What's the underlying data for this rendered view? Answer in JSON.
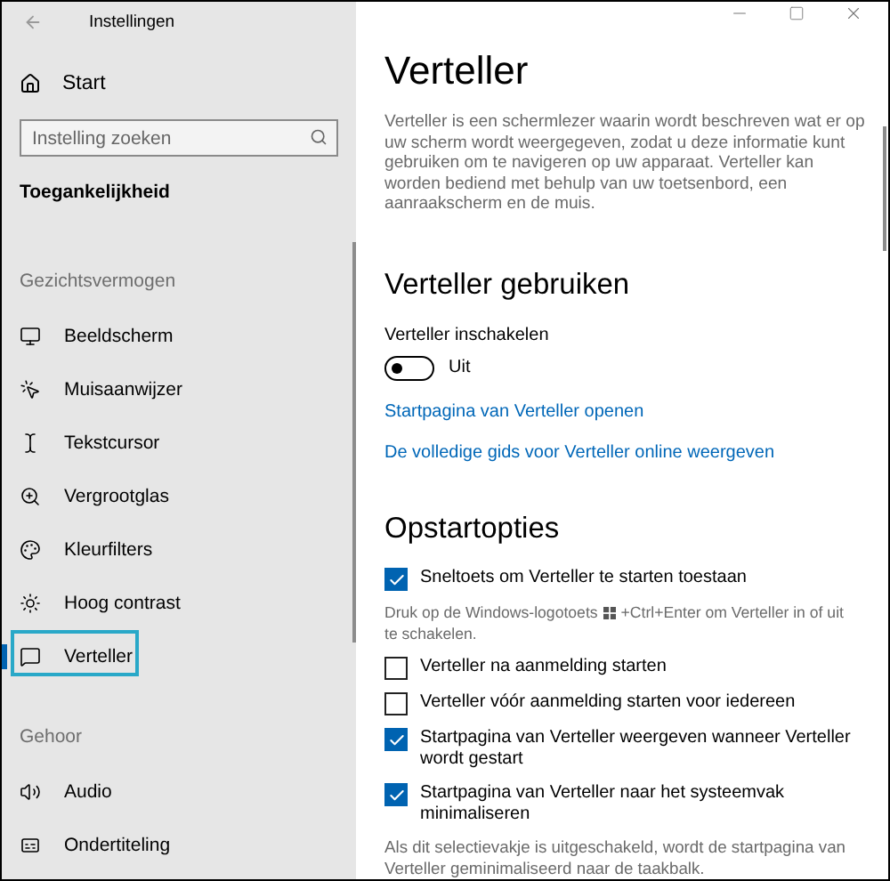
{
  "window": {
    "title": "Instellingen"
  },
  "sidebar": {
    "home": "Start",
    "search": {
      "placeholder": "Instelling zoeken"
    },
    "category": "Toegankelijkheid",
    "groups": [
      {
        "heading": "Gezichtsvermogen",
        "items": [
          {
            "label": "Beeldscherm",
            "selected": false
          },
          {
            "label": "Muisaanwijzer",
            "selected": false
          },
          {
            "label": "Tekstcursor",
            "selected": false
          },
          {
            "label": "Vergrootglas",
            "selected": false
          },
          {
            "label": "Kleurfilters",
            "selected": false
          },
          {
            "label": "Hoog contrast",
            "selected": false
          },
          {
            "label": "Verteller",
            "selected": true
          }
        ]
      },
      {
        "heading": "Gehoor",
        "items": [
          {
            "label": "Audio",
            "selected": false
          },
          {
            "label": "Ondertiteling",
            "selected": false
          }
        ]
      }
    ]
  },
  "main": {
    "title": "Verteller",
    "intro": "Verteller is een schermlezer waarin wordt beschreven wat er op uw scherm wordt weergegeven, zodat u deze informatie kunt gebruiken om te navigeren op uw apparaat. Verteller kan worden bediend met behulp van uw toetsenbord, een aanraakscherm en de muis.",
    "use_section": {
      "heading": "Verteller gebruiken",
      "toggle": {
        "label": "Verteller inschakelen",
        "on": false,
        "state": "Uit"
      },
      "links": [
        "Startpagina van Verteller openen",
        "De volledige gids voor Verteller online weergeven"
      ]
    },
    "startup_section": {
      "heading": "Opstartopties",
      "options": [
        {
          "label": "Sneltoets om Verteller te starten toestaan",
          "checked": true,
          "hint_lines": [
            [
              "Druk op de Windows-logotoets",
              "+Ctrl+Enter om Verteller in of uit"
            ],
            [
              "te schakelen."
            ]
          ]
        },
        {
          "label": "Verteller na aanmelding starten",
          "checked": false
        },
        {
          "label": "Verteller vóór aanmelding starten voor iedereen",
          "checked": false
        },
        {
          "label": "Startpagina van Verteller weergeven wanneer Verteller wordt gestart",
          "checked": true
        },
        {
          "label": "Startpagina van Verteller naar het systeemvak minimaliseren",
          "checked": true,
          "note": "Als dit selectievakje is uitgeschakeld, wordt de startpagina van Verteller geminimaliseerd naar de taakbalk."
        }
      ]
    }
  }
}
